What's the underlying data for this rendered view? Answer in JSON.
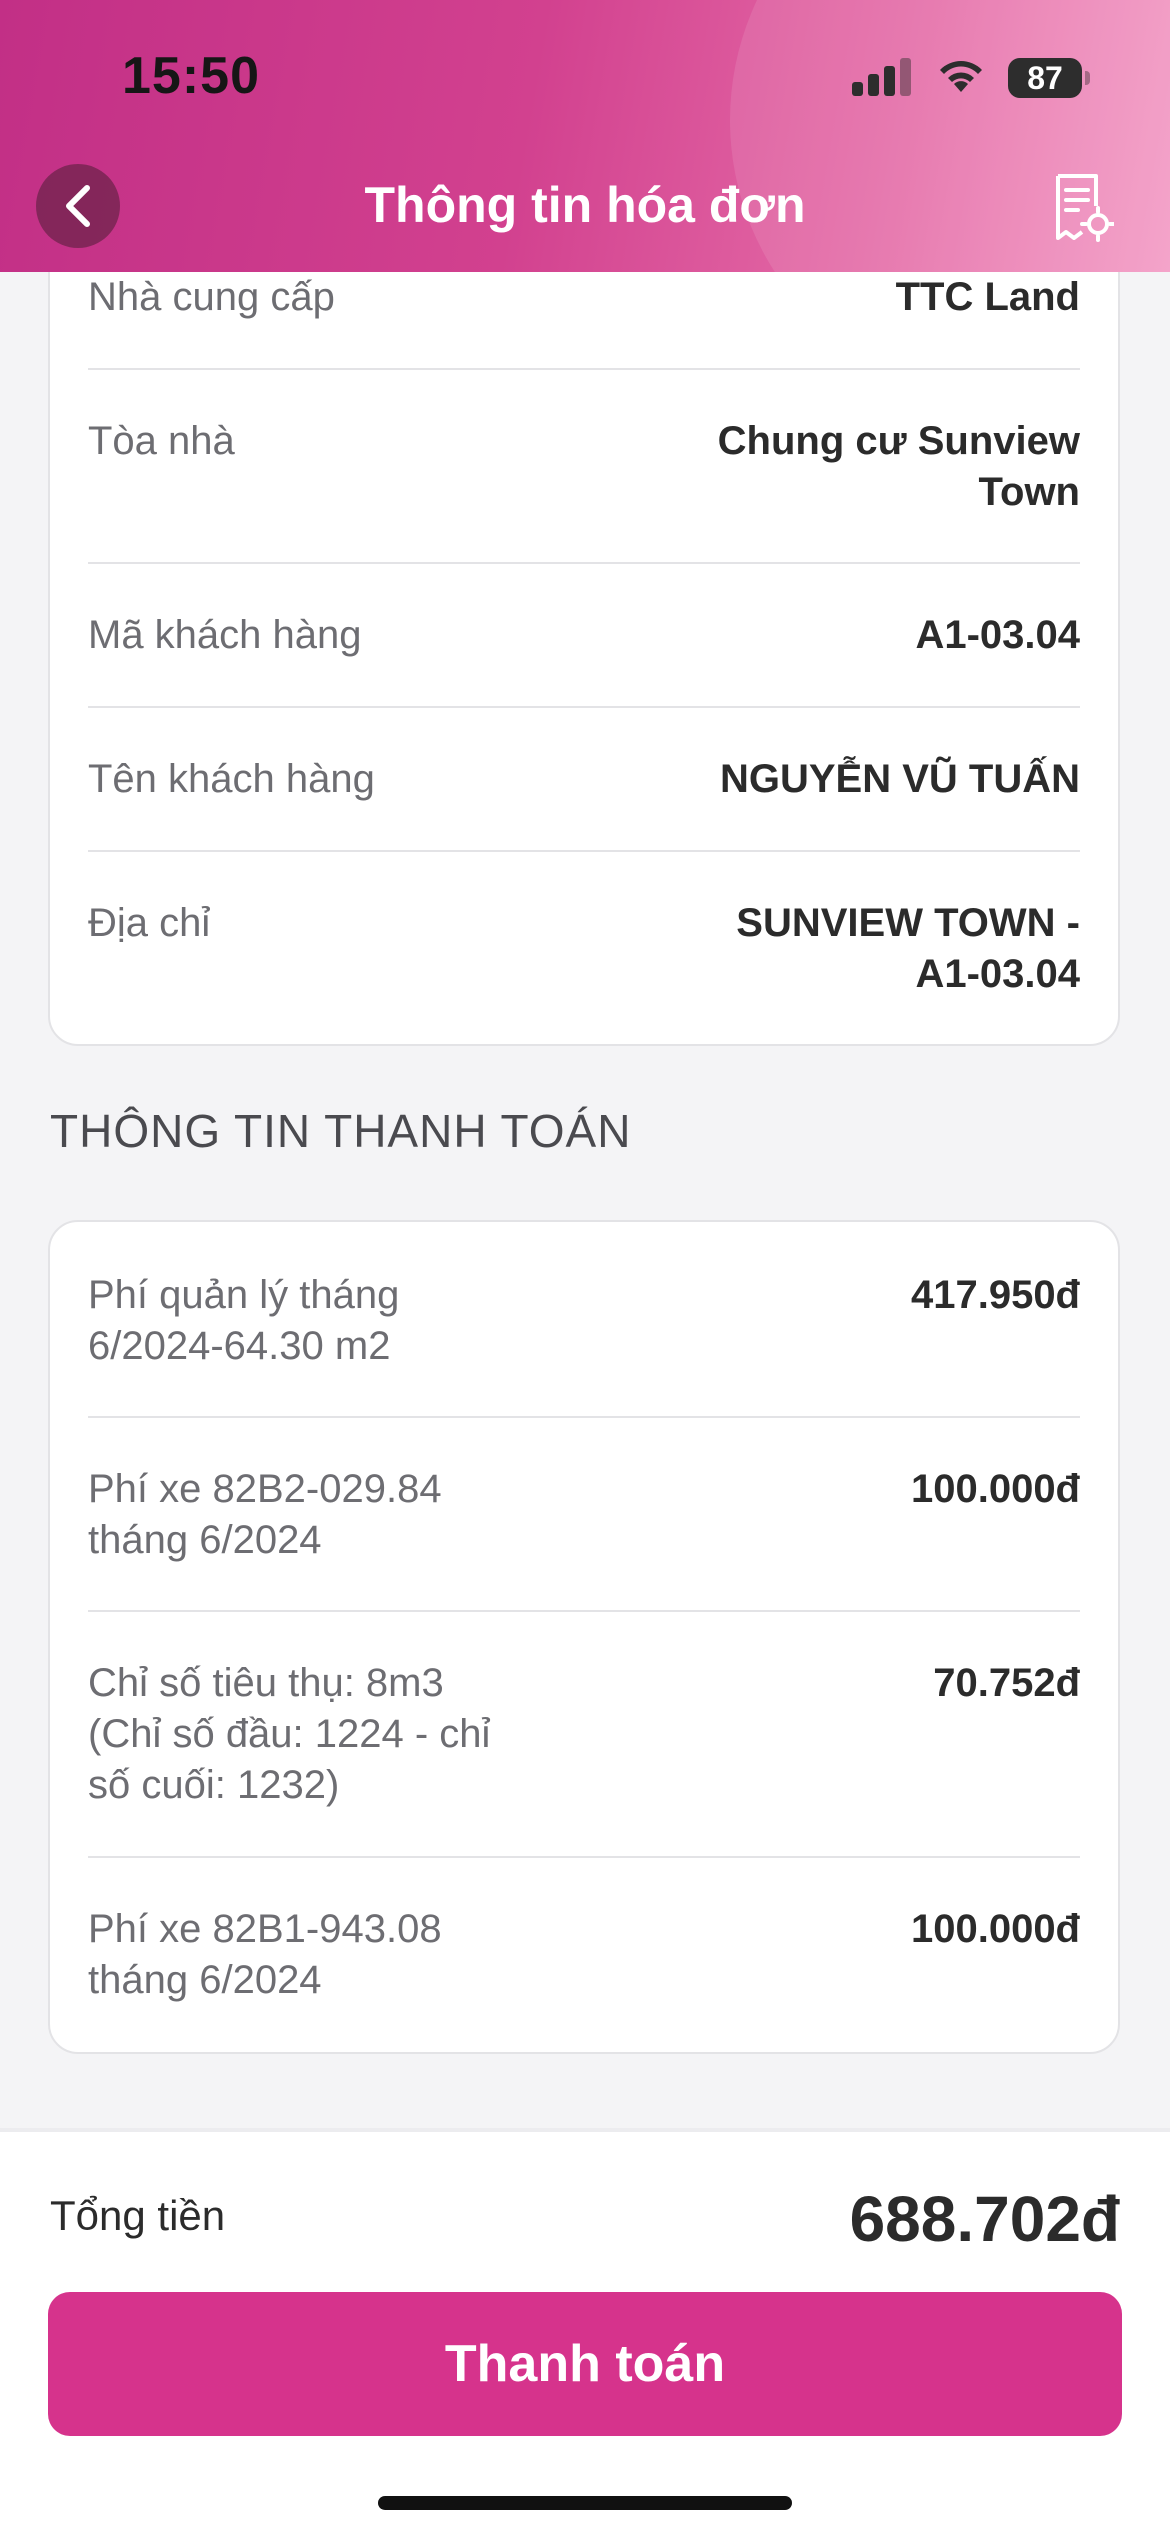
{
  "status_bar": {
    "time": "15:50",
    "battery": "87"
  },
  "header": {
    "title": "Thông tin hóa đơn"
  },
  "invoice_info": [
    {
      "label": "Nhà cung cấp",
      "value": "TTC Land"
    },
    {
      "label": "Tòa nhà",
      "value_line1": "Chung cư Sunview",
      "value_line2": "Town"
    },
    {
      "label": "Mã khách hàng",
      "value": "A1-03.04"
    },
    {
      "label": "Tên khách hàng",
      "value": "NGUYỄN VŨ TUẤN"
    },
    {
      "label": "Địa chỉ",
      "value_line1": "SUNVIEW TOWN -",
      "value_line2": "A1-03.04"
    }
  ],
  "payment_section": {
    "title": "THÔNG TIN THANH TOÁN",
    "items": [
      {
        "lines": [
          "Phí quản lý tháng",
          "6/2024-64.30 m2"
        ],
        "amount": "417.950đ"
      },
      {
        "lines": [
          "Phí xe 82B2-029.84",
          "tháng 6/2024"
        ],
        "amount": "100.000đ"
      },
      {
        "lines": [
          "Chỉ số tiêu thụ: 8m3",
          "(Chỉ số đầu: 1224 - chỉ",
          "số cuối: 1232)"
        ],
        "amount": "70.752đ"
      },
      {
        "lines": [
          "Phí xe 82B1-943.08",
          "tháng 6/2024"
        ],
        "amount": "100.000đ"
      }
    ]
  },
  "footer": {
    "total_label": "Tổng tiền",
    "total_value": "688.702đ",
    "pay_button": "Thanh toán"
  },
  "colors": {
    "brand": "#d6338c",
    "header_start": "#c22f86",
    "header_end": "#f39ac4"
  }
}
